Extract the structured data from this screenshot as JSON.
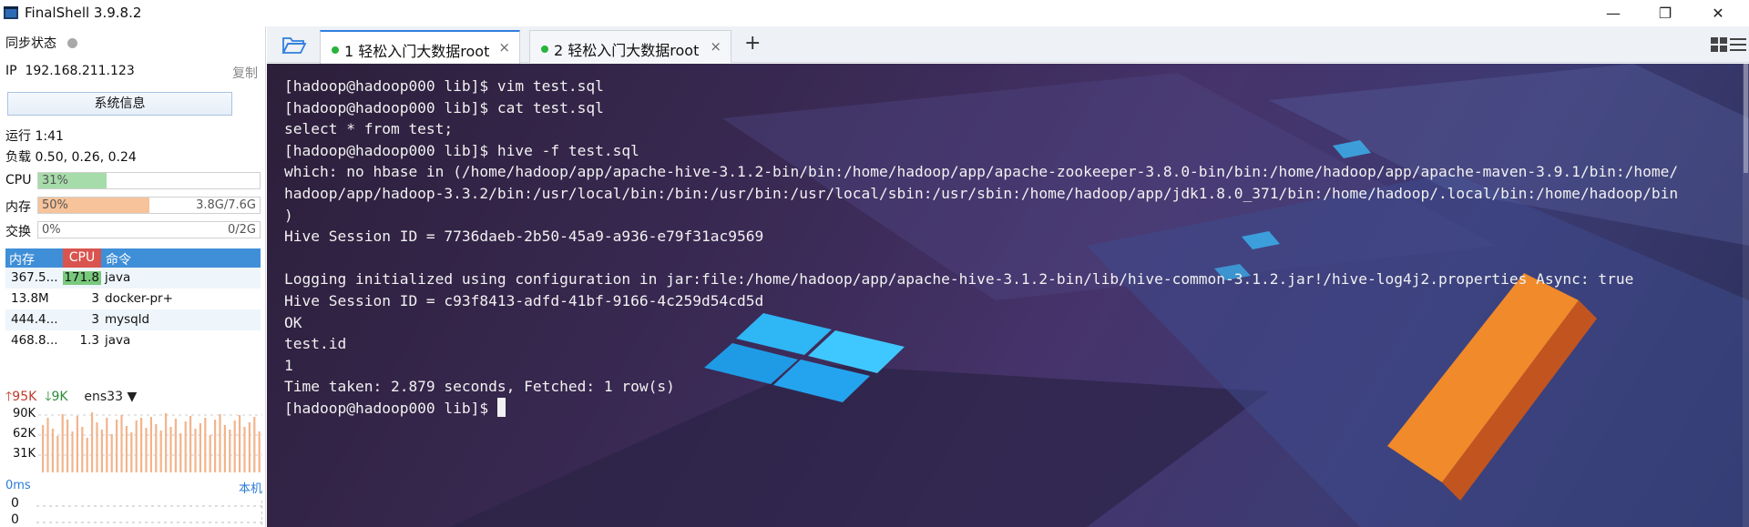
{
  "window": {
    "title": "FinalShell 3.9.8.2",
    "minimize_glyph": "—",
    "restore_glyph": "❐",
    "close_glyph": "✕"
  },
  "sidebar": {
    "sync_label": "同步状态",
    "ip_label": "IP",
    "ip_value": "192.168.211.123",
    "copy_label": "复制",
    "sysinfo_button": "系统信息",
    "uptime": "运行 1:41",
    "load": "负载 0.50, 0.26, 0.24",
    "cpu": {
      "label": "CPU",
      "percent_text": "31%",
      "percent": 31
    },
    "memory": {
      "label": "内存",
      "percent_text": "50%",
      "percent": 50,
      "amount": "3.8G/7.6G"
    },
    "swap": {
      "label": "交换",
      "percent_text": "0%",
      "percent": 0,
      "amount": "0/2G"
    },
    "process_table": {
      "headers": {
        "mem": "内存",
        "cpu": "CPU",
        "cmd": "命令"
      },
      "rows": [
        {
          "mem": "367.5...",
          "cpu": "171.8",
          "cpu_load": 1.0,
          "cmd": "java"
        },
        {
          "mem": "13.8M",
          "cpu": "3",
          "cpu_load": 0.0,
          "cmd": "docker-pr+"
        },
        {
          "mem": "444.4...",
          "cpu": "3",
          "cpu_load": 0.0,
          "cmd": "mysqld"
        },
        {
          "mem": "468.8...",
          "cpu": "1.3",
          "cpu_load": 0.0,
          "cmd": "java"
        }
      ]
    },
    "network": {
      "up": "95K",
      "down": "9K",
      "interface": "ens33",
      "axis": [
        "90K",
        "62K",
        "31K"
      ]
    },
    "ping": {
      "latency": "0ms",
      "host": "本机",
      "values": [
        "0",
        "0",
        "0"
      ]
    }
  },
  "tabs": [
    {
      "label": "1 轻松入门大数据root",
      "active": true,
      "close": "×"
    },
    {
      "label": "2 轻松入门大数据root",
      "active": false,
      "close": "×"
    }
  ],
  "add_tab_glyph": "+",
  "terminal": {
    "lines": [
      "[hadoop@hadoop000 lib]$ vim test.sql",
      "[hadoop@hadoop000 lib]$ cat test.sql",
      "select * from test;",
      "[hadoop@hadoop000 lib]$ hive -f test.sql",
      "which: no hbase in (/home/hadoop/app/apache-hive-3.1.2-bin/bin:/home/hadoop/app/apache-zookeeper-3.8.0-bin/bin:/home/hadoop/app/apache-maven-3.9.1/bin:/home/",
      "hadoop/app/hadoop-3.3.2/bin:/usr/local/bin:/bin:/usr/bin:/usr/local/sbin:/usr/sbin:/home/hadoop/app/jdk1.8.0_371/bin:/home/hadoop/.local/bin:/home/hadoop/bin",
      ")",
      "Hive Session ID = 7736daeb-2b50-45a9-a936-e79f31ac9569",
      "",
      "Logging initialized using configuration in jar:file:/home/hadoop/app/apache-hive-3.1.2-bin/lib/hive-common-3.1.2.jar!/hive-log4j2.properties Async: true",
      "Hive Session ID = c93f8413-adfd-41bf-9166-4c259d54cd5d",
      "OK",
      "test.id",
      "1",
      "Time taken: 2.879 seconds, Fetched: 1 row(s)"
    ],
    "prompt": "[hadoop@hadoop000 lib]$ "
  },
  "colors": {
    "cpu_fill": "#a6dca9",
    "mem_fill": "#f7c39a",
    "tab_accent": "#2f7fe0",
    "net_bar": "#f2b48c"
  }
}
